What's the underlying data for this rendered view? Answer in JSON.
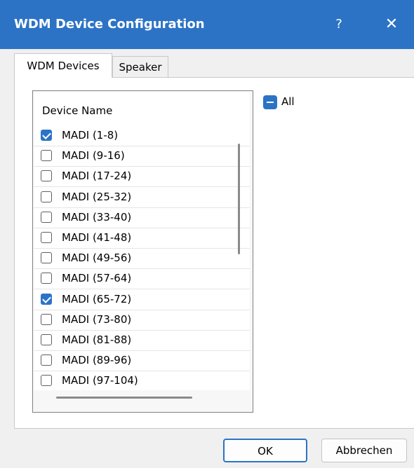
{
  "window": {
    "title": "WDM Device Configuration",
    "help_label": "?",
    "close_label": "✕"
  },
  "tabs": [
    {
      "label": "WDM Devices",
      "active": true
    },
    {
      "label": "Speaker",
      "active": false
    }
  ],
  "list": {
    "column_header": "Device Name",
    "items": [
      {
        "label": "MADI (1-8)",
        "checked": true
      },
      {
        "label": "MADI (9-16)",
        "checked": false
      },
      {
        "label": "MADI (17-24)",
        "checked": false
      },
      {
        "label": "MADI (25-32)",
        "checked": false
      },
      {
        "label": "MADI (33-40)",
        "checked": false
      },
      {
        "label": "MADI (41-48)",
        "checked": false
      },
      {
        "label": "MADI (49-56)",
        "checked": false
      },
      {
        "label": "MADI (57-64)",
        "checked": false
      },
      {
        "label": "MADI (65-72)",
        "checked": true
      },
      {
        "label": "MADI (73-80)",
        "checked": false
      },
      {
        "label": "MADI (81-88)",
        "checked": false
      },
      {
        "label": "MADI (89-96)",
        "checked": false
      },
      {
        "label": "MADI (97-104)",
        "checked": false
      }
    ]
  },
  "all_toggle": {
    "label": "All",
    "state": "indeterminate"
  },
  "buttons": {
    "ok": "OK",
    "cancel": "Abbrechen"
  },
  "colors": {
    "accent": "#2c73c6",
    "background": "#f0f0f0"
  }
}
